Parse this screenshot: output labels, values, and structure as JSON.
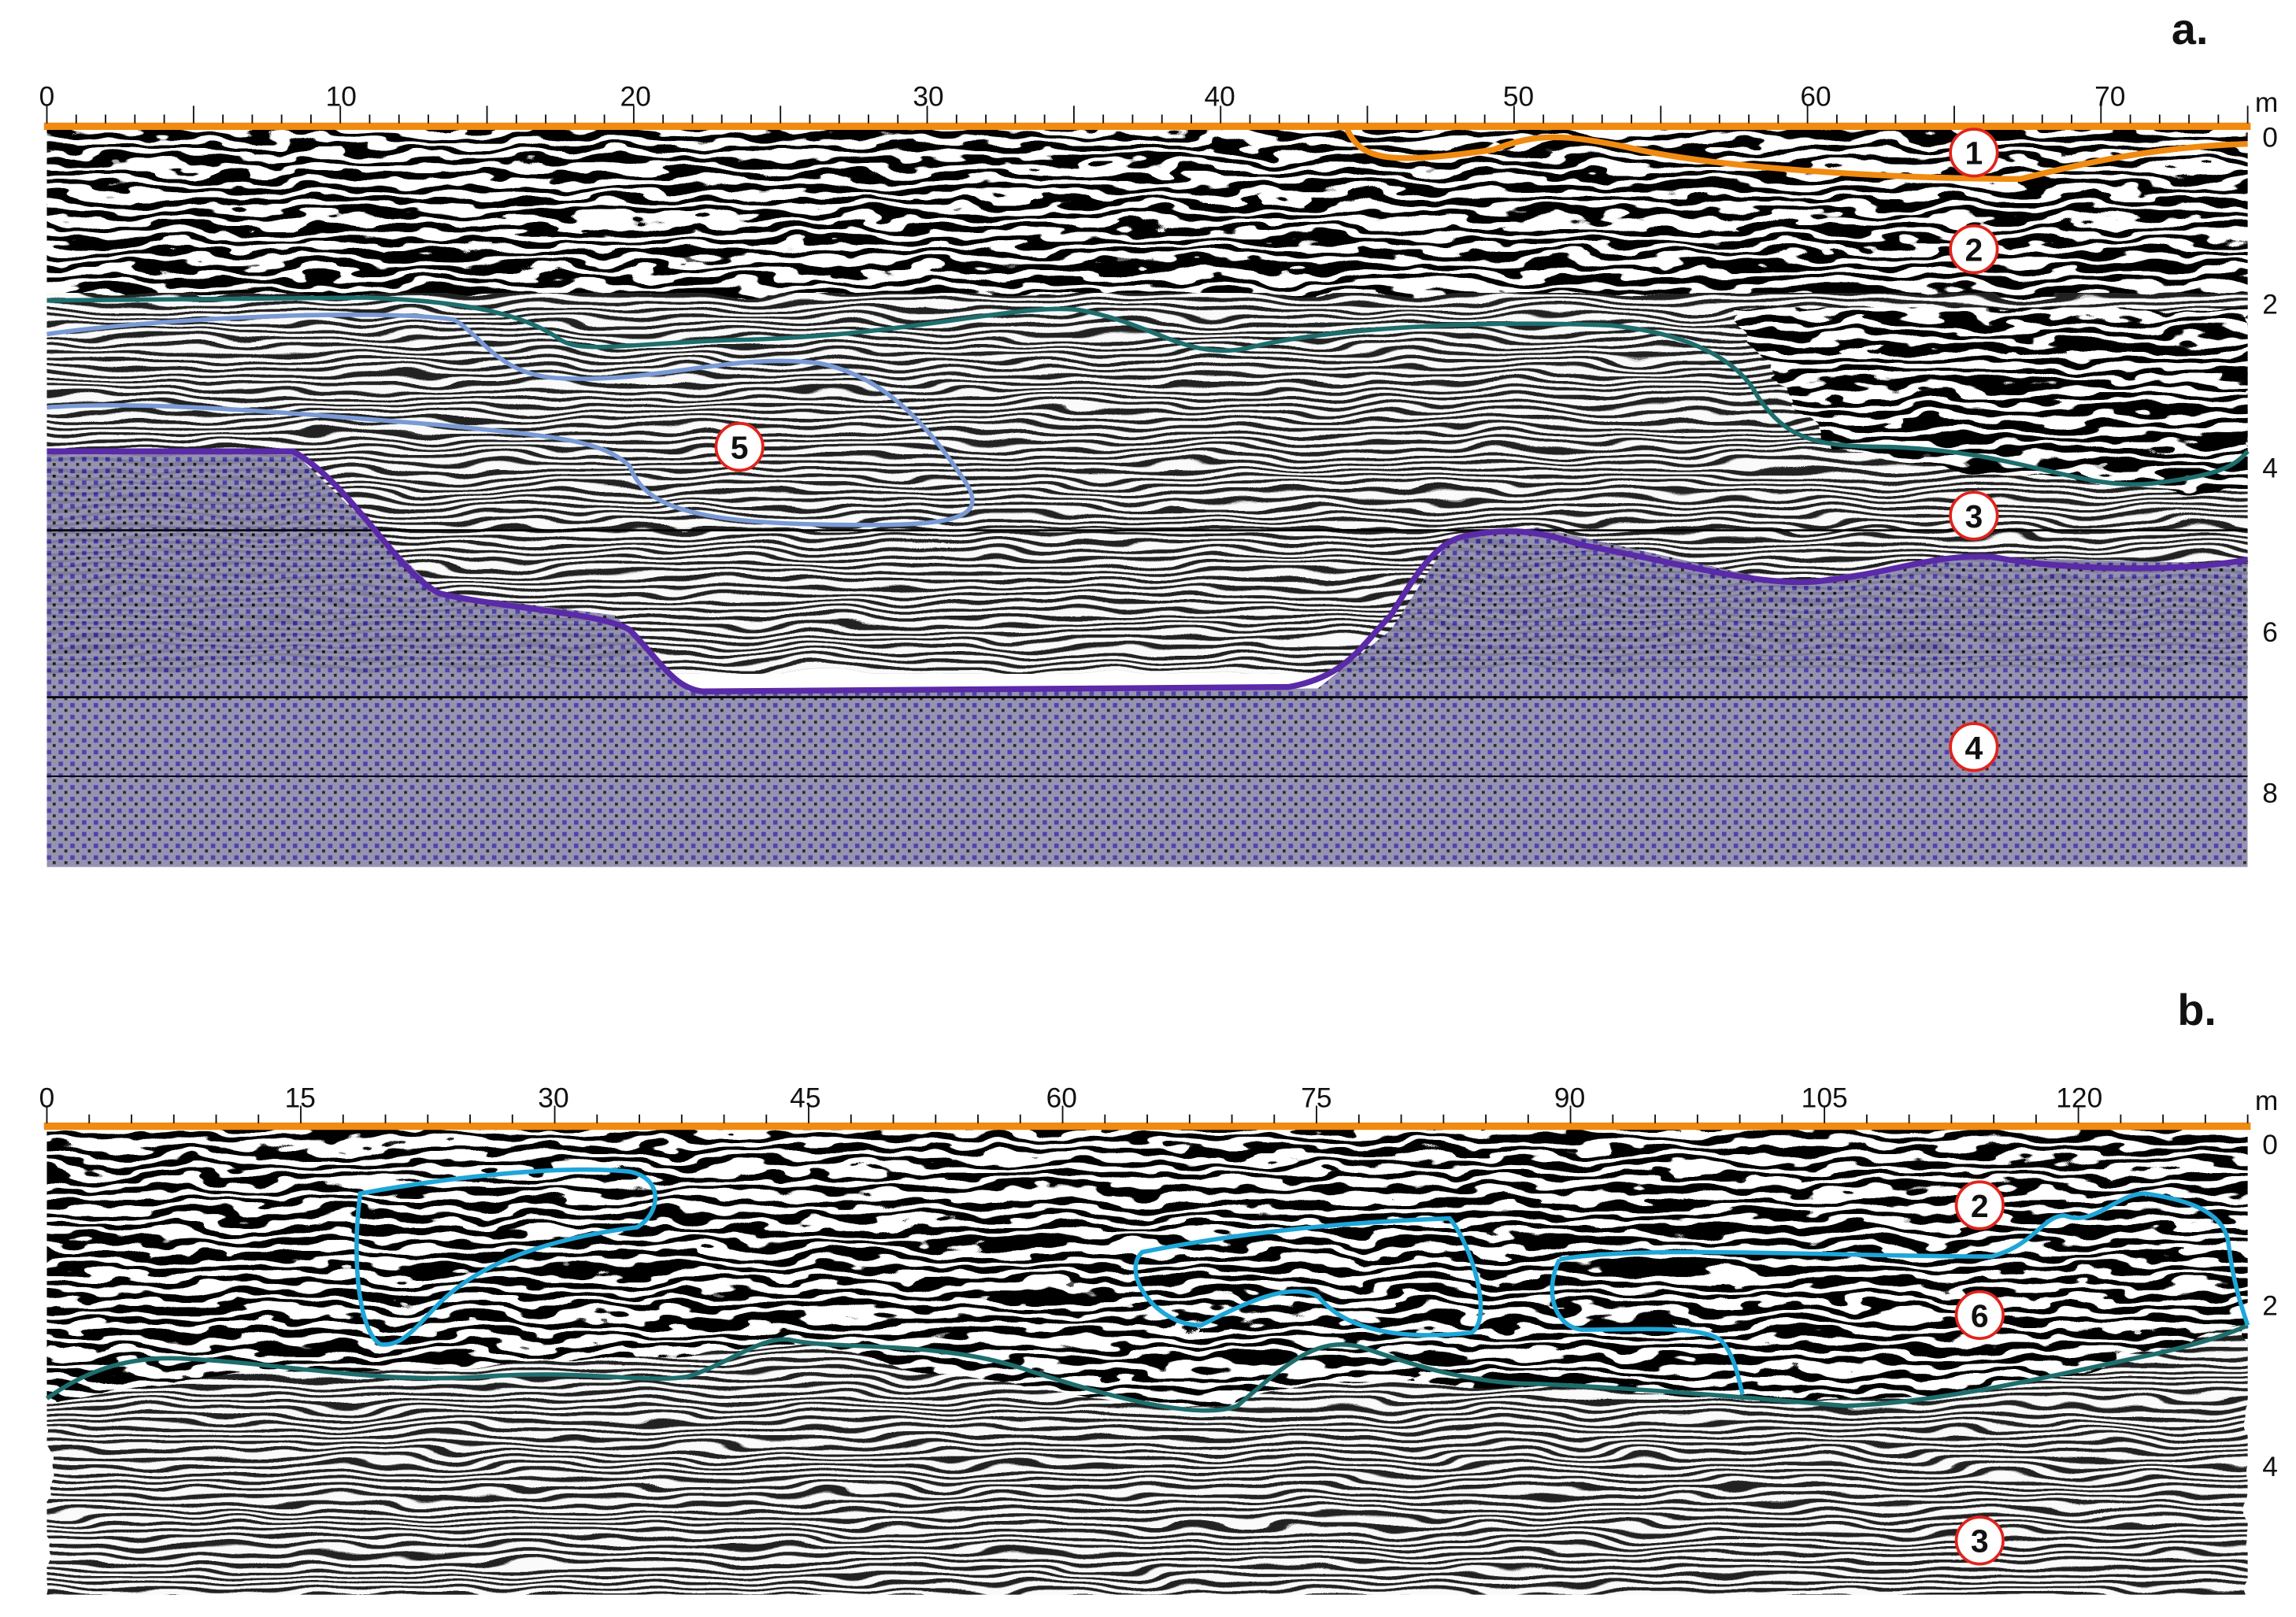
{
  "chart_data": [
    {
      "type": "radargram",
      "panel_label": "a.",
      "x_unit": "m",
      "x_ticks": [
        "0",
        "10",
        "20",
        "30",
        "40",
        "50",
        "60",
        "70"
      ],
      "x_range": [
        0,
        75
      ],
      "depth_ticks": [
        "0",
        "2",
        "4",
        "6",
        "8"
      ],
      "depth_range": [
        0,
        9
      ],
      "units": [
        "1",
        "2",
        "3",
        "4",
        "5"
      ],
      "interfaces": [
        {
          "name": "unit-1 base",
          "color": "#f08a10"
        },
        {
          "name": "unit-2 base",
          "color": "#1e6e6e"
        },
        {
          "name": "unit-5 outline",
          "color": "#7a9ad6"
        },
        {
          "name": "unit-4 top",
          "color": "#5a2aa8"
        }
      ]
    },
    {
      "type": "radargram",
      "panel_label": "b.",
      "x_unit": "m",
      "x_ticks": [
        "0",
        "15",
        "30",
        "45",
        "60",
        "75",
        "90",
        "105",
        "120"
      ],
      "x_range": [
        0,
        131
      ],
      "depth_ticks": [
        "0",
        "2",
        "4"
      ],
      "depth_range": [
        0,
        5.6
      ],
      "units": [
        "2",
        "6",
        "3"
      ],
      "interfaces": [
        {
          "name": "unit-6 outlines",
          "color": "#1ea6d8"
        },
        {
          "name": "unit-2 base",
          "color": "#1e6e6e"
        }
      ]
    }
  ],
  "colors": {
    "surface": "#f08a10",
    "label_ring": "#e0231c"
  }
}
